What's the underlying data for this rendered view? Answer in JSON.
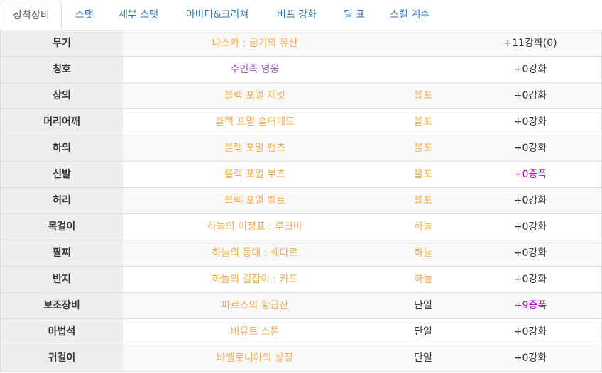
{
  "tabs": [
    {
      "label": "장착장비"
    },
    {
      "label": "스탯"
    },
    {
      "label": "세부 스탯"
    },
    {
      "label": "아바타&크리쳐"
    },
    {
      "label": "버프 강화"
    },
    {
      "label": "딜 표"
    },
    {
      "label": "스킬 계수"
    }
  ],
  "colors": {
    "item_gold": "#f0ad4e",
    "title_purple": "#9b59b6",
    "amplify_magenta": "#c000c0",
    "tab_link": "#337ab7",
    "slot_bg": "#eeeeee"
  },
  "equipment": [
    {
      "slot": "무기",
      "item": "나스카 : 금기의 유산",
      "item_color": "gold",
      "set": "",
      "set_color": "gold",
      "enhance": "+11강화(0)",
      "enhance_color": "dark"
    },
    {
      "slot": "칭호",
      "item": "수인족 영웅",
      "item_color": "purple",
      "set": "",
      "set_color": "gold",
      "enhance": "+0강화",
      "enhance_color": "dark"
    },
    {
      "slot": "상의",
      "item": "블랙 포멀 재킷",
      "item_color": "gold",
      "set": "블포",
      "set_color": "gold",
      "enhance": "+0강화",
      "enhance_color": "dark"
    },
    {
      "slot": "머리어깨",
      "item": "블랙 포멀 숄더패드",
      "item_color": "gold",
      "set": "블포",
      "set_color": "gold",
      "enhance": "+0강화",
      "enhance_color": "dark"
    },
    {
      "slot": "하의",
      "item": "블랙 포멀 팬츠",
      "item_color": "gold",
      "set": "블포",
      "set_color": "gold",
      "enhance": "+0강화",
      "enhance_color": "dark"
    },
    {
      "slot": "신발",
      "item": "블랙 포멀 부츠",
      "item_color": "gold",
      "set": "블포",
      "set_color": "gold",
      "enhance": "+0증폭",
      "enhance_color": "magenta"
    },
    {
      "slot": "허리",
      "item": "블랙 포멀 벨트",
      "item_color": "gold",
      "set": "블포",
      "set_color": "gold",
      "enhance": "+0강화",
      "enhance_color": "dark"
    },
    {
      "slot": "목걸이",
      "item": "하늘의 이정표 : 루크바",
      "item_color": "gold",
      "set": "하늘",
      "set_color": "gold",
      "enhance": "+0강화",
      "enhance_color": "dark"
    },
    {
      "slot": "팔찌",
      "item": "하늘의 등대 : 쉐다르",
      "item_color": "gold",
      "set": "하늘",
      "set_color": "gold",
      "enhance": "+0강화",
      "enhance_color": "dark"
    },
    {
      "slot": "반지",
      "item": "하늘의 길잡이 : 카프",
      "item_color": "gold",
      "set": "하늘",
      "set_color": "gold",
      "enhance": "+0강화",
      "enhance_color": "dark"
    },
    {
      "slot": "보조장비",
      "item": "파르스의 황금잔",
      "item_color": "gold",
      "set": "단일",
      "set_color": "dark",
      "enhance": "+9증폭",
      "enhance_color": "magenta"
    },
    {
      "slot": "마법석",
      "item": "비뮤트 스톤",
      "item_color": "gold",
      "set": "단일",
      "set_color": "dark",
      "enhance": "+0강화",
      "enhance_color": "dark"
    },
    {
      "slot": "귀걸이",
      "item": "바벨로니아의 상징",
      "item_color": "gold",
      "set": "단일",
      "set_color": "dark",
      "enhance": "+0강화",
      "enhance_color": "dark"
    }
  ]
}
